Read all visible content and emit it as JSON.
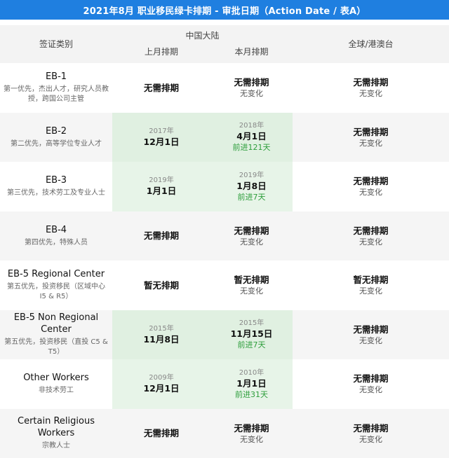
{
  "title": "2021年8月 职业移民绿卡排期 - 审批日期（Action Date / 表A）",
  "header": {
    "category": "签证类别",
    "china_group": "中国大陆",
    "china_prev": "上月排期",
    "china_curr": "本月排期",
    "global": "全球/港澳台"
  },
  "rows": [
    {
      "name": "EB-1",
      "desc": "第一优先，杰出人才，研究人员教授，跨国公司主管",
      "prev_year": "",
      "prev_date": "无需排期",
      "curr_year": "",
      "curr_date": "无需排期",
      "curr_status": "无变化",
      "global_date": "无需排期",
      "global_status": "无变化"
    },
    {
      "name": "EB-2",
      "desc": "第二优先，高等学位专业人才",
      "prev_year": "2017年",
      "prev_date": "12月1日",
      "curr_year": "2018年",
      "curr_date": "4月1日",
      "curr_advance": "前进121天",
      "global_date": "无需排期",
      "global_status": "无变化"
    },
    {
      "name": "EB-3",
      "desc": "第三优先，技术劳工及专业人士",
      "prev_year": "2019年",
      "prev_date": "1月1日",
      "curr_year": "2019年",
      "curr_date": "1月8日",
      "curr_advance": "前进7天",
      "global_date": "无需排期",
      "global_status": "无变化"
    },
    {
      "name": "EB-4",
      "desc": "第四优先，特殊人员",
      "prev_year": "",
      "prev_date": "无需排期",
      "curr_year": "",
      "curr_date": "无需排期",
      "curr_status": "无变化",
      "global_date": "无需排期",
      "global_status": "无变化"
    },
    {
      "name": "EB-5 Regional Center",
      "desc": "第五优先，投资移民（区域中心 I5 & R5）",
      "prev_year": "",
      "prev_date": "暂无排期",
      "curr_year": "",
      "curr_date": "暂无排期",
      "curr_status": "无变化",
      "global_date": "暂无排期",
      "global_status": "无变化"
    },
    {
      "name": "EB-5 Non Regional Center",
      "desc": "第五优先，投资移民（直投 C5 & T5）",
      "prev_year": "2015年",
      "prev_date": "11月8日",
      "curr_year": "2015年",
      "curr_date": "11月15日",
      "curr_advance": "前进7天",
      "global_date": "无需排期",
      "global_status": "无变化"
    },
    {
      "name": "Other Workers",
      "desc": "非技术劳工",
      "prev_year": "2009年",
      "prev_date": "12月1日",
      "curr_year": "2010年",
      "curr_date": "1月1日",
      "curr_advance": "前进31天",
      "global_date": "无需排期",
      "global_status": "无变化"
    },
    {
      "name": "Certain Religious Workers",
      "desc": "宗教人士",
      "prev_year": "",
      "prev_date": "无需排期",
      "curr_year": "",
      "curr_date": "无需排期",
      "curr_status": "无变化",
      "global_date": "无需排期",
      "global_status": "无变化"
    }
  ],
  "colors": {
    "title_bg": "#1f7fe0",
    "highlight_bg": "#e7f4e8",
    "advance_text": "#2e9e3c"
  }
}
